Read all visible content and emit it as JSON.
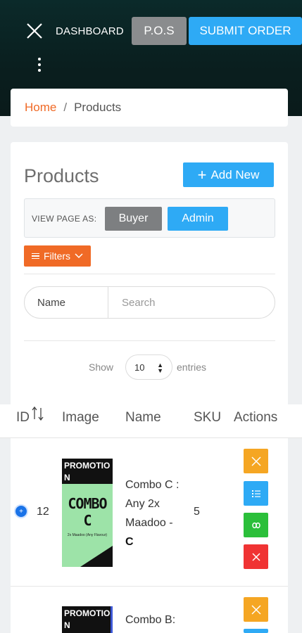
{
  "header": {
    "dashboard_label": "DASHBOARD",
    "pos_label": "P.O.S",
    "submit_label": "SUBMIT ORDER"
  },
  "breadcrumb": {
    "home": "Home",
    "separator": "/",
    "current": "Products"
  },
  "page": {
    "title": "Products",
    "add_new_label": "Add New",
    "view_as_label": "VIEW PAGE AS:",
    "buyer_label": "Buyer",
    "admin_label": "Admin",
    "filters_label": "Filters"
  },
  "search": {
    "field_label": "Name",
    "placeholder": "Search"
  },
  "pagination": {
    "show_label": "Show",
    "page_size": "10",
    "entries_label": "entries"
  },
  "table": {
    "columns": [
      "ID",
      "Image",
      "Name",
      "SKU",
      "Actions"
    ],
    "rows": [
      {
        "id": "12",
        "image_text_top": "PROMOTIO N",
        "image_text_main": "COMBO C",
        "image_text_sub": "2x Maadoo (Any Flavour)",
        "name_plain": "Combo C : Any 2x Maadoo - ",
        "name_bold": "C",
        "sku": "5"
      },
      {
        "image_text_top": "PROMOTIO N",
        "name_plain": "Combo B:"
      }
    ]
  },
  "colors": {
    "accent_orange": "#f06a26",
    "accent_blue": "#2eaaf5",
    "neutral_gray": "#8a8c8e",
    "action_orange": "#f5a623",
    "action_green": "#2bbf3a",
    "action_red": "#f03333"
  }
}
